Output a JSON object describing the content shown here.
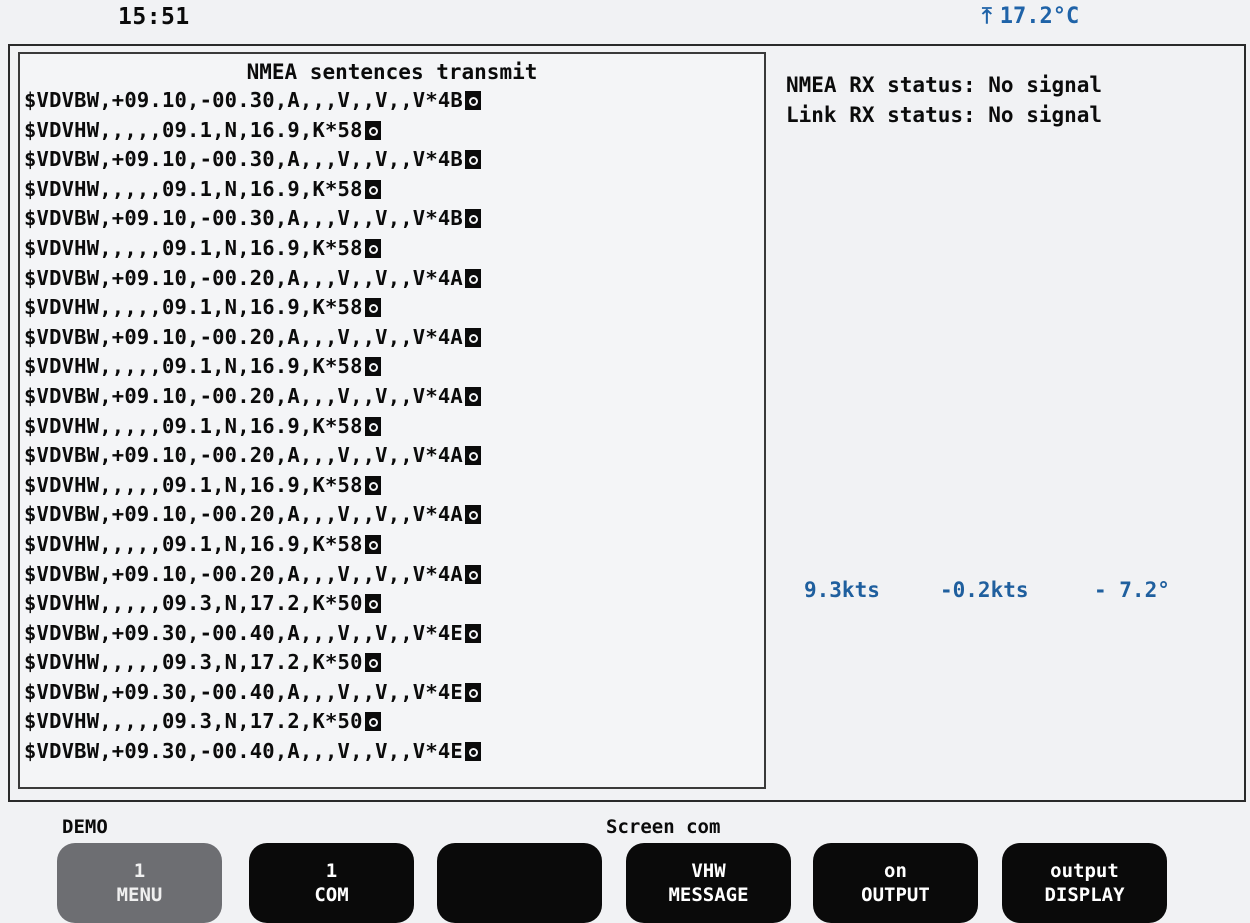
{
  "topbar": {
    "time": "15:51",
    "temperature": "17.2°C",
    "temperature_icon": "thermometer-icon"
  },
  "transmit": {
    "title": "NMEA sentences transmit",
    "lines": [
      "$VDVBW,+09.10,-00.30,A,,,V,,V,,V*4B",
      "$VDVHW,,,,,09.1,N,16.9,K*58",
      "$VDVBW,+09.10,-00.30,A,,,V,,V,,V*4B",
      "$VDVHW,,,,,09.1,N,16.9,K*58",
      "$VDVBW,+09.10,-00.30,A,,,V,,V,,V*4B",
      "$VDVHW,,,,,09.1,N,16.9,K*58",
      "$VDVBW,+09.10,-00.20,A,,,V,,V,,V*4A",
      "$VDVHW,,,,,09.1,N,16.9,K*58",
      "$VDVBW,+09.10,-00.20,A,,,V,,V,,V*4A",
      "$VDVHW,,,,,09.1,N,16.9,K*58",
      "$VDVBW,+09.10,-00.20,A,,,V,,V,,V*4A",
      "$VDVHW,,,,,09.1,N,16.9,K*58",
      "$VDVBW,+09.10,-00.20,A,,,V,,V,,V*4A",
      "$VDVHW,,,,,09.1,N,16.9,K*58",
      "$VDVBW,+09.10,-00.20,A,,,V,,V,,V*4A",
      "$VDVHW,,,,,09.1,N,16.9,K*58",
      "$VDVBW,+09.10,-00.20,A,,,V,,V,,V*4A",
      "$VDVHW,,,,,09.3,N,17.2,K*50",
      "$VDVBW,+09.30,-00.40,A,,,V,,V,,V*4E",
      "$VDVHW,,,,,09.3,N,17.2,K*50",
      "$VDVBW,+09.30,-00.40,A,,,V,,V,,V*4E",
      "$VDVHW,,,,,09.3,N,17.2,K*50",
      "$VDVBW,+09.30,-00.40,A,,,V,,V,,V*4E"
    ]
  },
  "status": {
    "nmea_rx": "NMEA RX status: No signal",
    "link_rx": "Link RX status: No signal"
  },
  "readout": {
    "speed": "9.3kts",
    "drift": "-0.2kts",
    "heading": "- 7.2°"
  },
  "footer": {
    "mode": "DEMO",
    "screen": "Screen  com"
  },
  "softkeys": [
    {
      "top": "1",
      "bottom": "MENU",
      "active": true
    },
    {
      "top": "1",
      "bottom": "COM",
      "active": false
    },
    {
      "top": "",
      "bottom": "",
      "active": false
    },
    {
      "top": "VHW",
      "bottom": "MESSAGE",
      "active": false
    },
    {
      "top": "on",
      "bottom": "OUTPUT",
      "active": false
    },
    {
      "top": "output",
      "bottom": "DISPLAY",
      "active": false
    }
  ],
  "colors": {
    "accent": "#1f63a8",
    "key_bg": "#0a0a0a",
    "key_active_bg": "#6d6e72"
  }
}
